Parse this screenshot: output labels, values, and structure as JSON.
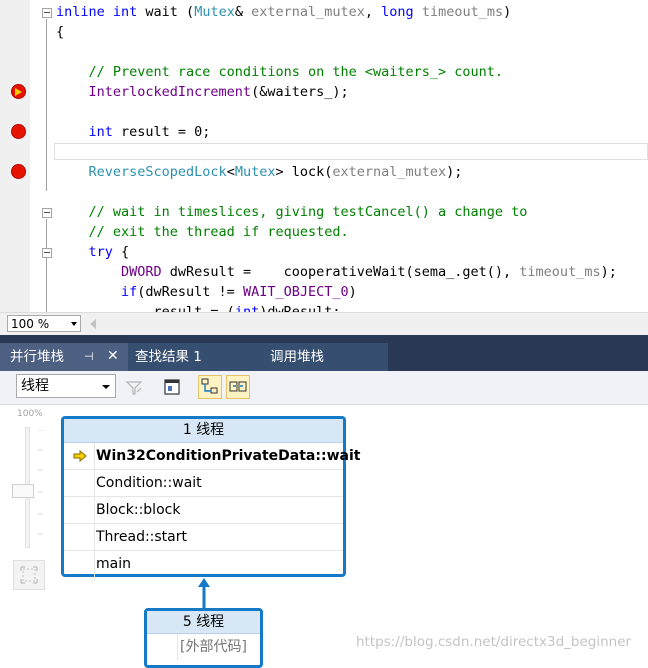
{
  "editor": {
    "lines": [
      {
        "tokens": [
          [
            "kw",
            "inline "
          ],
          [
            "kw",
            "int "
          ],
          [
            "tx",
            "wait ("
          ],
          [
            "ty",
            "Mutex"
          ],
          [
            "tx",
            "& "
          ],
          [
            "pm",
            "external_mutex"
          ],
          [
            "tx",
            ", "
          ],
          [
            "kw",
            "long "
          ],
          [
            "pm",
            "timeout_ms"
          ],
          [
            "tx",
            ")"
          ]
        ]
      },
      {
        "tokens": [
          [
            "tx",
            "{"
          ]
        ]
      },
      {
        "tokens": []
      },
      {
        "tokens": [
          [
            "cm",
            "    // Prevent race conditions on the <waiters_> count."
          ]
        ]
      },
      {
        "tokens": [
          [
            "fn",
            "    InterlockedIncrement"
          ],
          [
            "tx",
            "(&waiters_);"
          ]
        ]
      },
      {
        "tokens": []
      },
      {
        "tokens": [
          [
            "kw",
            "    int "
          ],
          [
            "tx",
            "result = 0;"
          ]
        ]
      },
      {
        "tokens": []
      },
      {
        "tokens": [
          [
            "ty",
            "    ReverseScopedLock"
          ],
          [
            "tx",
            "<"
          ],
          [
            "ty",
            "Mutex"
          ],
          [
            "tx",
            "> lock("
          ],
          [
            "pm",
            "external_mutex"
          ],
          [
            "tx",
            ");"
          ]
        ]
      },
      {
        "tokens": []
      },
      {
        "tokens": [
          [
            "cm",
            "    // wait in timeslices, giving testCancel() a change to"
          ]
        ]
      },
      {
        "tokens": [
          [
            "cm",
            "    // exit the thread if requested."
          ]
        ]
      },
      {
        "tokens": [
          [
            "kw",
            "    try "
          ],
          [
            "tx",
            "{"
          ]
        ]
      },
      {
        "tokens": [
          [
            "fn",
            "        DWORD "
          ],
          [
            "tx",
            "dwResult =    cooperativeWait(sema_.get(), "
          ],
          [
            "pm",
            "timeout_ms"
          ],
          [
            "tx",
            ");"
          ]
        ]
      },
      {
        "tokens": [
          [
            "kw",
            "        if"
          ],
          [
            "tx",
            "(dwResult != "
          ],
          [
            "fn",
            "WAIT_OBJECT_0"
          ],
          [
            "tx",
            ")"
          ]
        ]
      },
      {
        "tokens": [
          [
            "tx",
            "            result = ("
          ],
          [
            "kw",
            "int"
          ],
          [
            "tx",
            ")dwResult;"
          ]
        ]
      }
    ]
  },
  "zoom": {
    "value": "100 %"
  },
  "tabs": [
    {
      "label": "并行堆栈"
    },
    {
      "label": "查找结果 1"
    },
    {
      "label": "调用堆栈"
    }
  ],
  "toolbar": {
    "thread_select": "线程"
  },
  "diagram": {
    "zoom_label": "100%",
    "main_node": {
      "header": "1 线程",
      "frames": [
        "Win32ConditionPrivateData::wait",
        "Condition::wait",
        "Block::block",
        "Thread::start",
        "main"
      ]
    },
    "sub_node": {
      "header": "5 线程",
      "frames": [
        "[外部代码]"
      ]
    }
  },
  "watermark": "https://blog.csdn.net/directx3d_beginner",
  "colors": {
    "breakpoint": "#e51400",
    "node_border": "#1479c6",
    "tab_bg": "#293955",
    "current_frame_arrow": "#f5d000"
  }
}
